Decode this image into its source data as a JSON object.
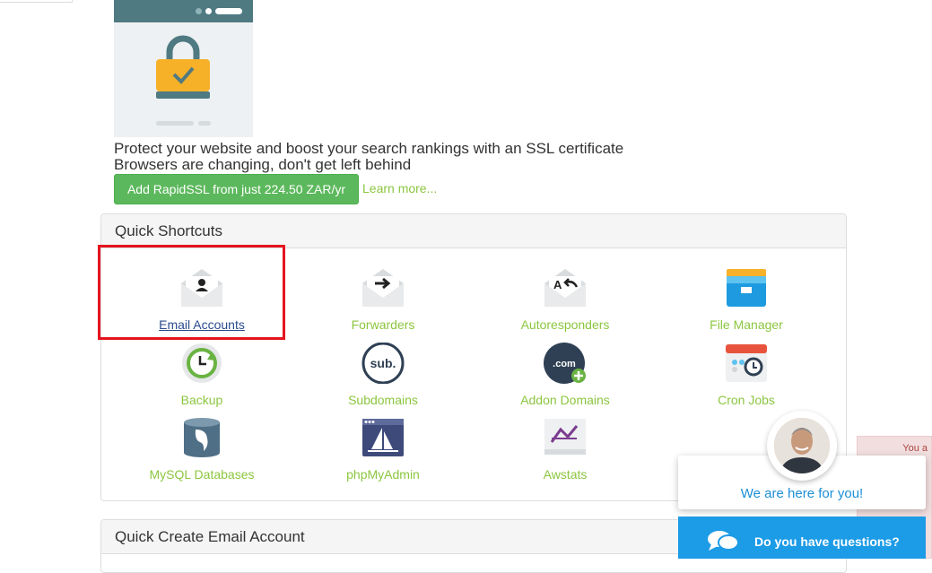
{
  "ssl": {
    "line1": "Protect your website and boost your search rankings with an SSL certificate",
    "line2": "Browsers are changing, don't get left behind",
    "button": "Add RapidSSL from just 224.50 ZAR/yr",
    "learn_more": "Learn more..."
  },
  "shortcuts": {
    "title": "Quick Shortcuts",
    "items": [
      {
        "label": "Email Accounts",
        "icon": "email-accounts-icon"
      },
      {
        "label": "Forwarders",
        "icon": "forwarders-icon"
      },
      {
        "label": "Autoresponders",
        "icon": "autoresponders-icon"
      },
      {
        "label": "File Manager",
        "icon": "file-manager-icon"
      },
      {
        "label": "Backup",
        "icon": "backup-icon"
      },
      {
        "label": "Subdomains",
        "icon": "subdomains-icon"
      },
      {
        "label": "Addon Domains",
        "icon": "addon-domains-icon"
      },
      {
        "label": "Cron Jobs",
        "icon": "cron-jobs-icon"
      },
      {
        "label": "MySQL Databases",
        "icon": "mysql-databases-icon"
      },
      {
        "label": "phpMyAdmin",
        "icon": "phpmyadmin-icon"
      },
      {
        "label": "Awstats",
        "icon": "awstats-icon"
      }
    ],
    "icon_text": {
      "sub": "sub.",
      "com": ".com"
    }
  },
  "quick_create": {
    "title": "Quick Create Email Account"
  },
  "chat": {
    "message": "We are here for you!",
    "question": "Do you have questions?",
    "notice_fragment": "You a"
  },
  "colors": {
    "accent_green": "#8cc63f",
    "button_green": "#5cb85c",
    "chat_blue": "#1c9be6",
    "highlight_red": "#e5141f"
  }
}
